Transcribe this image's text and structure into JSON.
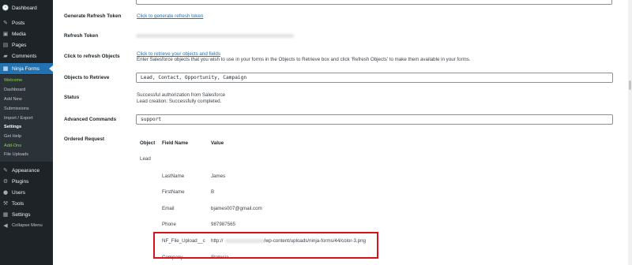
{
  "sidebar": {
    "items": [
      {
        "label": "Dashboard",
        "icon": "🕐"
      },
      {
        "label": "Posts",
        "icon": "✎"
      },
      {
        "label": "Media",
        "icon": "▣"
      },
      {
        "label": "Pages",
        "icon": "▤"
      },
      {
        "label": "Comments",
        "icon": "▰"
      },
      {
        "label": "Ninja Forms",
        "icon": "▦"
      }
    ],
    "submenu": [
      "Welcome",
      "Dashboard",
      "Add New",
      "Submissions",
      "Import / Export",
      "Settings",
      "Get Help",
      "Add-Ons",
      "File Uploads"
    ],
    "lower_items": [
      {
        "label": "Appearance",
        "icon": "✎"
      },
      {
        "label": "Plugins",
        "icon": "⚙"
      },
      {
        "label": "Users",
        "icon": "●"
      },
      {
        "label": "Tools",
        "icon": "⚒"
      },
      {
        "label": "Settings",
        "icon": "▦"
      },
      {
        "label": "Collapse Menu",
        "icon": "◀"
      }
    ],
    "accent": "#2271b1"
  },
  "settings": {
    "generate_token": {
      "label": "Generate Refresh Token",
      "link": "Click to generate refresh token"
    },
    "refresh_token": {
      "label": "Refresh Token"
    },
    "refresh_objects": {
      "label": "Click to refresh Objects",
      "link": "Click to retrieve your objects and fields",
      "help": "Enter Salesforce objects that you wish to use in your forms in the Objects to Retrieve box and click 'Refresh Objects' to make them available in your forms."
    },
    "objects_to_retrieve": {
      "label": "Objects to Retrieve",
      "value": "Lead, Contact, Opportunity, Campaign"
    },
    "status": {
      "label": "Status",
      "line1": "Successful authorization from Salesforce",
      "line2": "Lead creation: Successfully completed."
    },
    "advanced_commands": {
      "label": "Advanced Commands",
      "value": "support"
    },
    "ordered_request": {
      "label": "Ordered Request",
      "headers": [
        "Object",
        "Field Name",
        "Value"
      ],
      "object": "Lead",
      "rows": [
        {
          "field": "LastName",
          "value": "James"
        },
        {
          "field": "FirstName",
          "value": "B"
        },
        {
          "field": "Email",
          "value": "bjames007@gmail.com"
        },
        {
          "field": "Phone",
          "value": "987987565"
        },
        {
          "field": "NF_File_Upload__c",
          "value_prefix": "http://",
          "value_suffix": "/wp-content/uploads/ninja-forms/44/color-3.png"
        },
        {
          "field": "Company",
          "value": "Statesia"
        }
      ]
    },
    "highlight_color": "#d9111f"
  }
}
